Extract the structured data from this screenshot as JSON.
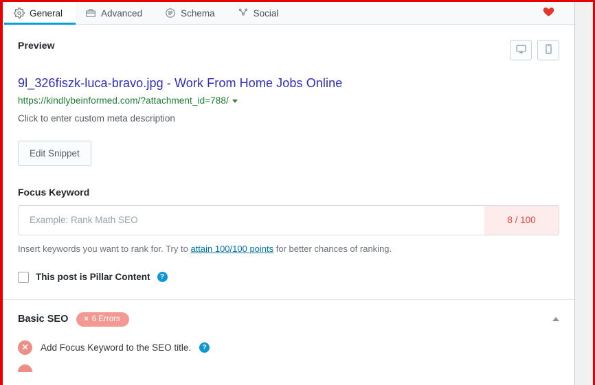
{
  "tabs": [
    {
      "id": "general",
      "label": "General",
      "icon": "gear-icon",
      "active": true
    },
    {
      "id": "advanced",
      "label": "Advanced",
      "icon": "briefcase-icon",
      "active": false
    },
    {
      "id": "schema",
      "label": "Schema",
      "icon": "list-circle-icon",
      "active": false
    },
    {
      "id": "social",
      "label": "Social",
      "icon": "share-icon",
      "active": false
    }
  ],
  "header": {
    "favorite_icon": "heart-icon",
    "favorite_color": "#e8352c"
  },
  "preview": {
    "heading": "Preview",
    "device_desktop_icon": "desktop-monitor-icon",
    "device_mobile_icon": "mobile-phone-icon",
    "snippet_title": "9l_326fiszk-luca-bravo.jpg - Work From Home Jobs Online",
    "snippet_url": "https://kindlybeinformed.com/?attachment_id=788/",
    "snippet_url_caret": "chevron-down-icon",
    "snippet_description": "Click to enter custom meta description",
    "edit_snippet_label": "Edit Snippet",
    "title_color": "#2d2dbb",
    "url_color": "#1a7e32"
  },
  "focus_keyword": {
    "label": "Focus Keyword",
    "placeholder": "Example: Rank Math SEO",
    "value": "",
    "score": "8 / 100",
    "score_color": "#e8413c",
    "score_bg": "#fdeceb",
    "help_before": "Insert keywords you want to rank for. Try to ",
    "help_link": "attain 100/100 points",
    "help_after": " for better chances of ranking."
  },
  "pillar": {
    "label": "This post is Pillar Content",
    "checked": false,
    "help_icon": "question-mark-icon",
    "help_glyph": "?"
  },
  "basic_seo": {
    "title": "Basic SEO",
    "error_badge": "6 Errors",
    "error_badge_x": "×",
    "badge_color": "#f29a92",
    "collapse_icon": "chevron-up-icon",
    "items": [
      {
        "status_icon": "error-x-circle-icon",
        "status_glyph": "✕",
        "text": "Add Focus Keyword to the SEO title.",
        "help_icon": "question-mark-icon",
        "help_glyph": "?"
      }
    ]
  }
}
